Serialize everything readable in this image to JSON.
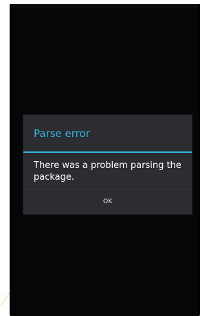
{
  "dialog": {
    "title": "Parse error",
    "message": "There was a problem parsing the package.",
    "ok_button": "OK"
  },
  "colors": {
    "accent": "#33b5e5",
    "dialog_background": "#2b2d30",
    "screen_background": "#050607"
  }
}
